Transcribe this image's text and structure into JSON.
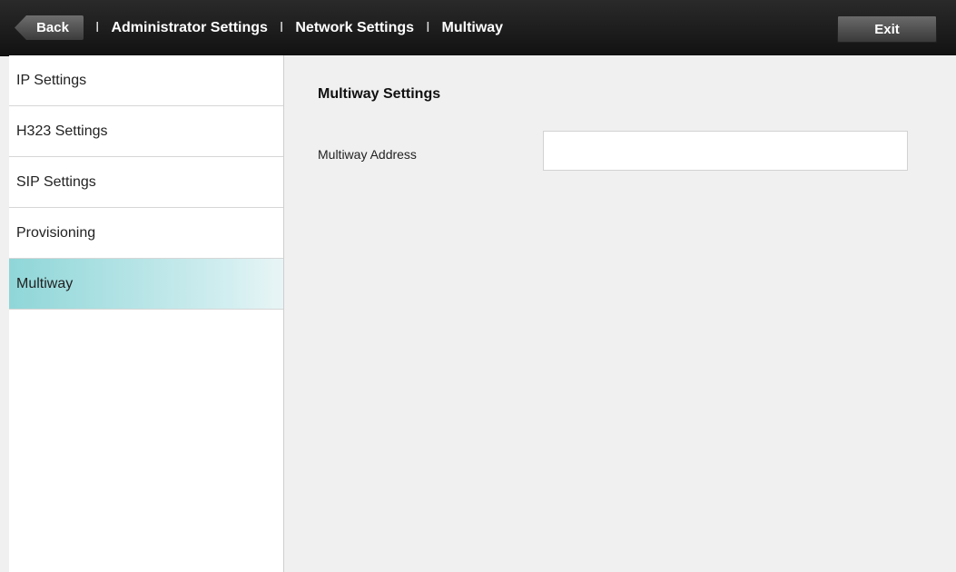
{
  "header": {
    "back_label": "Back",
    "separator": "I",
    "breadcrumbs": [
      "Administrator Settings",
      "Network Settings",
      "Multiway"
    ],
    "exit_label": "Exit"
  },
  "sidebar": {
    "items": [
      {
        "label": "IP Settings"
      },
      {
        "label": "H323 Settings"
      },
      {
        "label": "SIP Settings"
      },
      {
        "label": "Provisioning"
      },
      {
        "label": "Multiway",
        "active": true
      }
    ]
  },
  "main": {
    "section_title": "Multiway Settings",
    "fields": [
      {
        "label": "Multiway Address",
        "value": "",
        "placeholder": ""
      }
    ]
  },
  "colors": {
    "topbar": "#1a1a1a",
    "active_item": "#8fd6d8",
    "background": "#f0f0f0"
  }
}
